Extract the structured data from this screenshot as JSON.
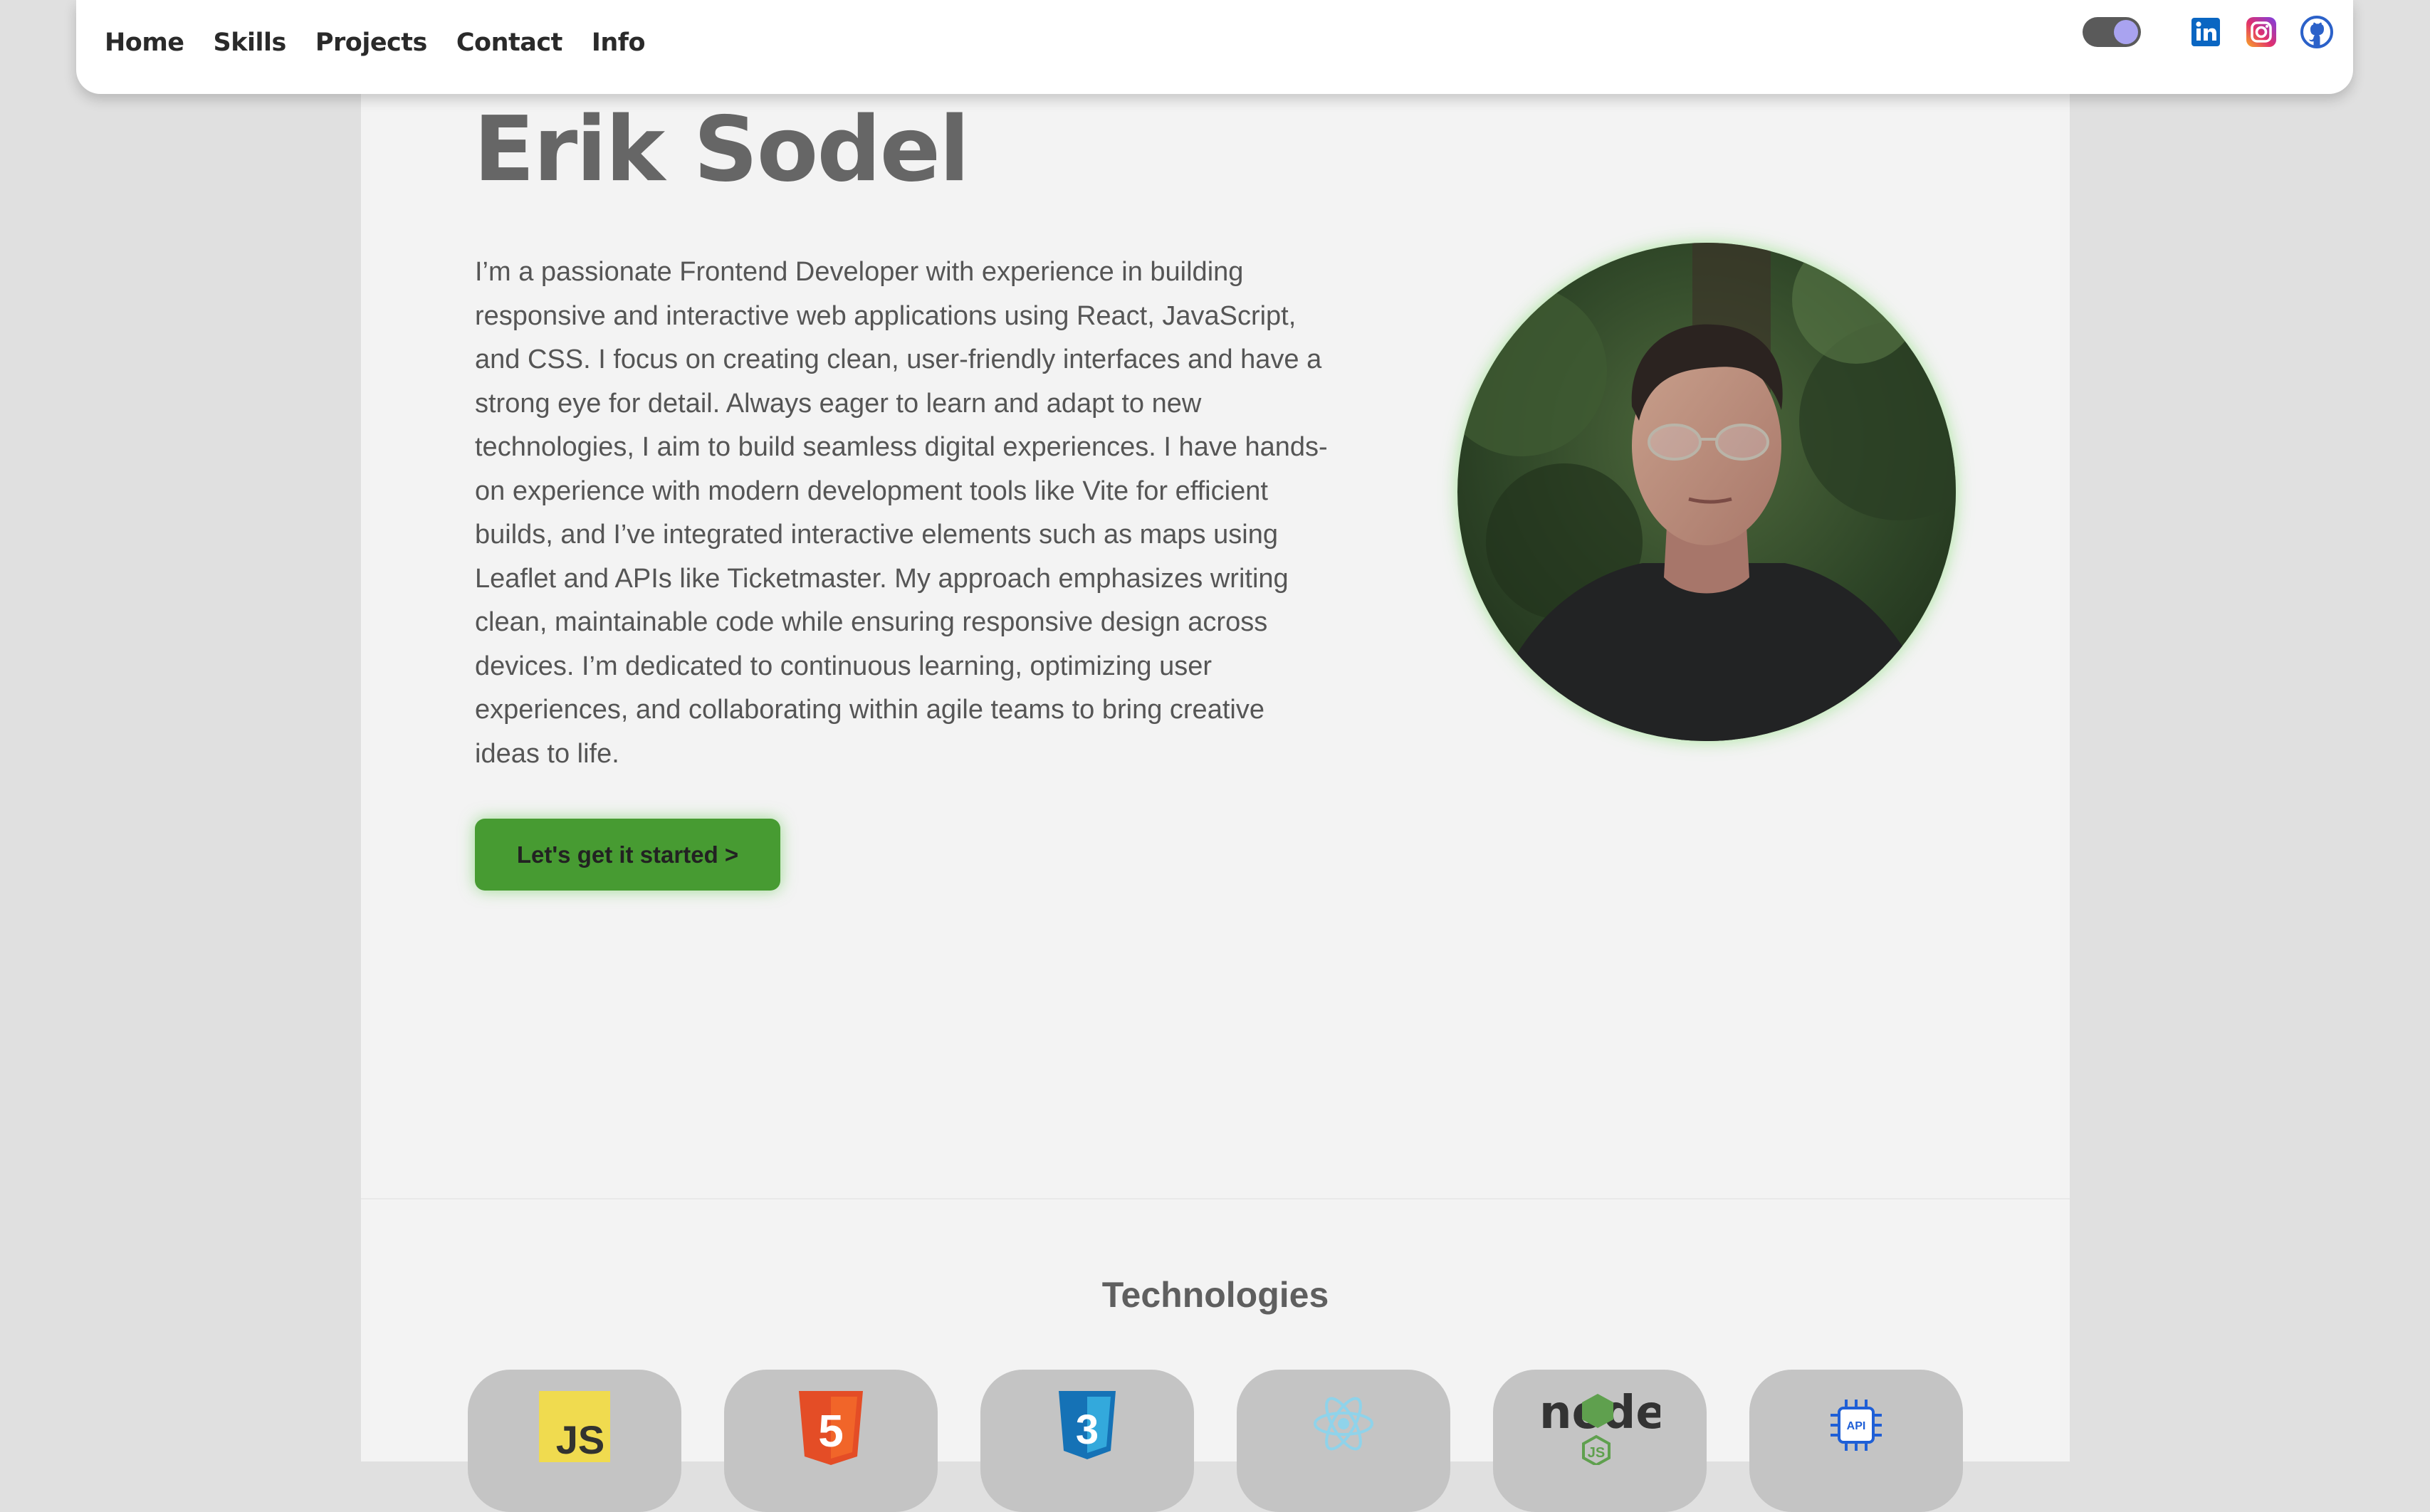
{
  "nav": {
    "links": [
      "Home",
      "Skills",
      "Projects",
      "Contact",
      "Info"
    ],
    "toggle": "theme-toggle",
    "social_icons": [
      "linkedin-icon",
      "instagram-icon",
      "github-icon"
    ],
    "social_colors": {
      "linkedin": "#0a66c2",
      "instagram": "#d6249f",
      "github": "#2b61c9"
    }
  },
  "hero": {
    "name": "Erik Sodel",
    "bio": "I’m a passionate Frontend Developer with experience in building responsive and interactive web applications using React, JavaScript, and CSS. I focus on creating clean, user-friendly interfaces and have a strong eye for detail. Always eager to learn and adapt to new technologies, I aim to build seamless digital experiences. I have hands-on experience with modern development tools like Vite for efficient builds, and I’ve integrated interactive elements such as maps using Leaflet and APIs like Ticketmaster. My approach emphasizes writing clean, maintainable code while ensuring responsive design across devices. I’m dedicated to continuous learning, optimizing user experiences, and collaborating within agile teams to bring creative ideas to life.",
    "cta_label": "Let's get it started >",
    "accent_color": "#479b32"
  },
  "technologies": {
    "title": "Technologies",
    "items": [
      {
        "icon": "javascript-icon",
        "label": "JS"
      },
      {
        "icon": "html5-icon",
        "label": "5"
      },
      {
        "icon": "css3-icon",
        "label": "3"
      },
      {
        "icon": "react-icon",
        "label": ""
      },
      {
        "icon": "nodejs-icon",
        "label": "node"
      },
      {
        "icon": "api-icon",
        "label": "API"
      }
    ]
  }
}
